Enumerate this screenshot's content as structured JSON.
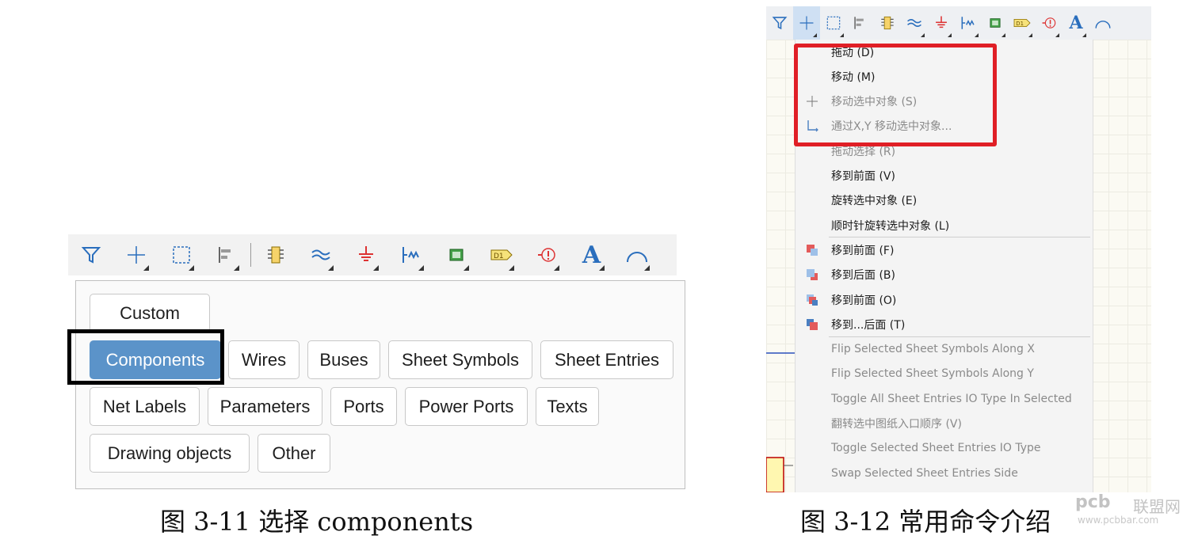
{
  "fig_left": {
    "toolbar_icons": [
      "filter-icon",
      "move-icon",
      "select-rect-icon",
      "align-icon",
      "component-icon",
      "wire-icon",
      "ground-icon",
      "bus-entry-icon",
      "sheet-symbol-icon",
      "net-port-icon",
      "directive-icon",
      "text-icon",
      "arc-icon"
    ],
    "chips": {
      "custom": "Custom",
      "components": "Components",
      "wires": "Wires",
      "buses": "Buses",
      "sheet_symbols": "Sheet Symbols",
      "sheet_entries": "Sheet Entries",
      "net_labels": "Net Labels",
      "parameters": "Parameters",
      "ports": "Ports",
      "power_ports": "Power Ports",
      "texts": "Texts",
      "drawing_objects": "Drawing objects",
      "other": "Other"
    },
    "caption": "图 3-11 选择 components"
  },
  "fig_right": {
    "toolbar_glyphs": {
      "d1": "D1",
      "text": "A"
    },
    "menu": [
      {
        "label": "拖动 (D)",
        "disabled": false
      },
      {
        "label": "移动 (M)",
        "disabled": false
      },
      {
        "label": "移动选中对象 (S)",
        "disabled": true
      },
      {
        "label": "通过X,Y 移动选中对象...",
        "disabled": true
      },
      {
        "label": "拖动选择 (R)",
        "disabled": true
      },
      {
        "label": "移到前面 (V)",
        "disabled": false
      },
      {
        "label": "旋转选中对象 (E)",
        "disabled": false
      },
      {
        "label": "顺时针旋转选中对象 (L)",
        "disabled": false
      },
      {
        "label": "移到前面 (F)",
        "disabled": false
      },
      {
        "label": "移到后面 (B)",
        "disabled": false
      },
      {
        "label": "移到前面 (O)",
        "disabled": false
      },
      {
        "label": "移到...后面 (T)",
        "disabled": false
      },
      {
        "label": "Flip Selected Sheet Symbols Along X",
        "disabled": true
      },
      {
        "label": "Flip Selected Sheet Symbols Along Y",
        "disabled": true
      },
      {
        "label": "Toggle All Sheet Entries IO Type In Selected",
        "disabled": true
      },
      {
        "label": "翻转选中图纸入口顺序 (V)",
        "disabled": true
      },
      {
        "label": "Toggle Selected Sheet Entries  IO Type",
        "disabled": true
      },
      {
        "label": "Swap Selected Sheet Entries Side",
        "disabled": true
      }
    ],
    "caption": "图 3-12 常用命令介绍"
  },
  "watermark": {
    "brand": "pcb",
    "brand_cn": "联盟网",
    "url": "www.pcbbar.com"
  }
}
